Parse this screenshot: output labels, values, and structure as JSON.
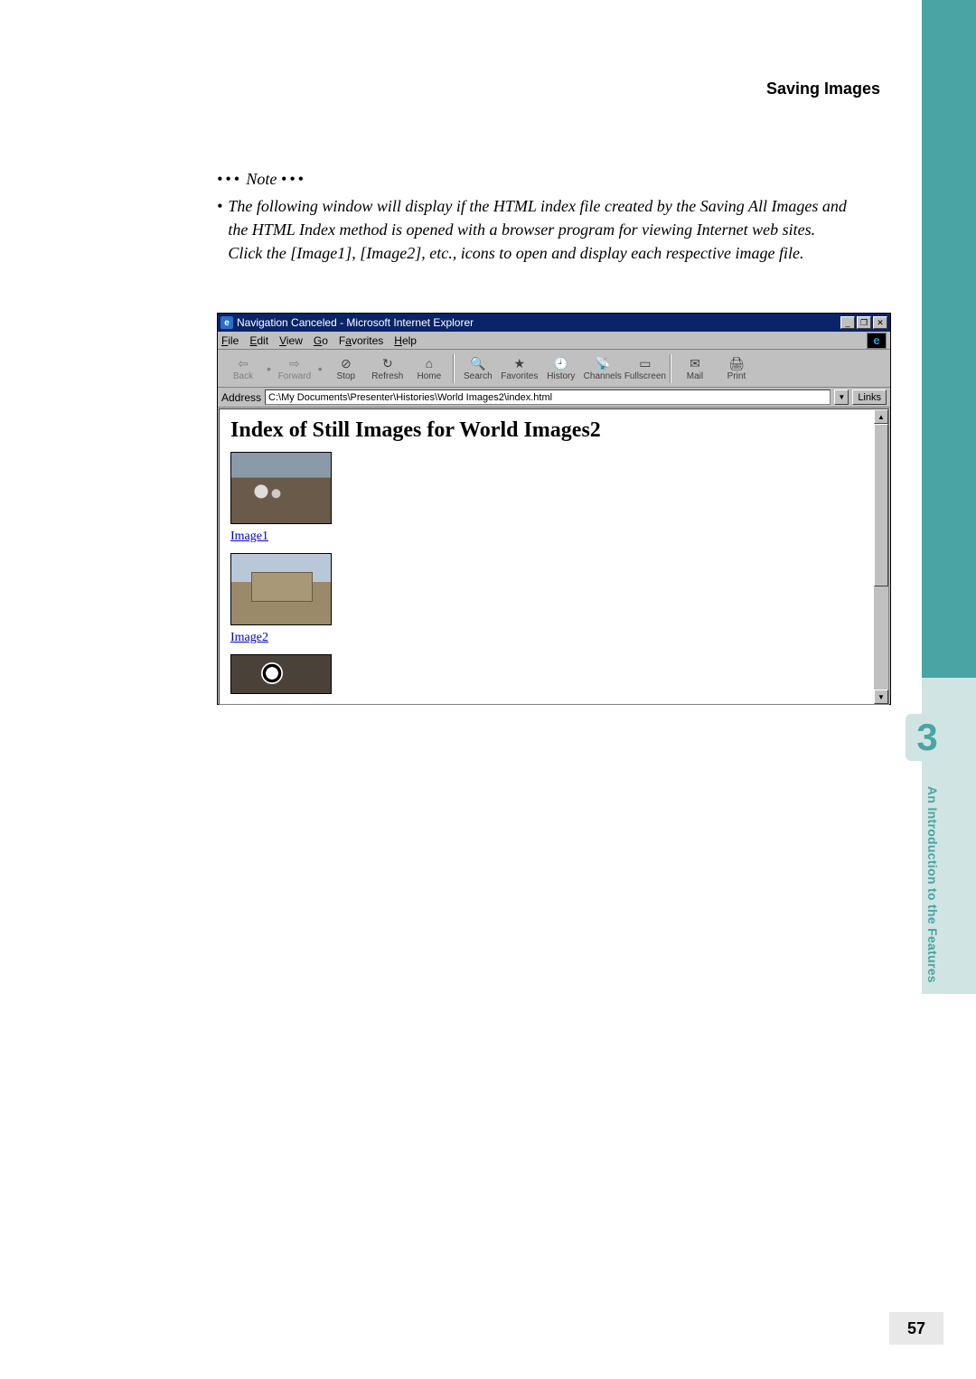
{
  "header": {
    "section_title": "Saving Images"
  },
  "note": {
    "heading_prefix": "•••",
    "heading_word": "Note",
    "heading_suffix": "•••",
    "bullet": "•",
    "text": "The following window will display if the HTML index file created by the Saving All Images and the HTML Index method is opened with a browser program for viewing Internet web sites. Click the [Image1], [Image2], etc., icons to open and display each respective image file."
  },
  "browser": {
    "title": "Navigation Canceled - Microsoft Internet Explorer",
    "window_controls": {
      "min": "_",
      "max": "❐",
      "close": "✕"
    },
    "menu": {
      "file": "File",
      "edit": "Edit",
      "view": "View",
      "go": "Go",
      "favorites": "Favorites",
      "help": "Help",
      "logo_letter": "e"
    },
    "toolbar": {
      "back": "Back",
      "forward": "Forward",
      "stop": "Stop",
      "refresh": "Refresh",
      "home": "Home",
      "search": "Search",
      "favorites": "Favorites",
      "history": "History",
      "channels": "Channels",
      "fullscreen": "Fullscreen",
      "mail": "Mail",
      "print": "Print"
    },
    "address": {
      "label": "Address",
      "value": "C:\\My Documents\\Presenter\\Histories\\World Images2\\index.html",
      "links": "Links"
    },
    "page": {
      "heading": "Index of Still Images for World Images2",
      "link1": "Image1",
      "link2": "Image2"
    }
  },
  "chapter": {
    "number": "3",
    "title": "An Introduction to the Features"
  },
  "page_number": "57"
}
